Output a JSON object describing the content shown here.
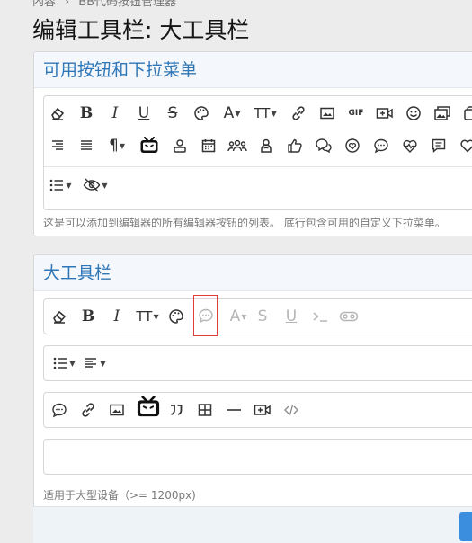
{
  "breadcrumb": {
    "part1": "内容",
    "part2": "BB代码按钮管理器"
  },
  "page": {
    "title": "编辑工具栏: 大工具栏"
  },
  "available_panel": {
    "title": "可用按钮和下拉菜单",
    "hint": "这是可以添加到编辑器的所有编辑器按钮的列表。 底行包含可用的自定义下拉菜单。",
    "icons_row1": [
      "clear-formatting-icon",
      "bold-icon",
      "italic-icon",
      "underline-icon",
      "strikethrough-icon",
      "palette-icon",
      "font-size-icon",
      "text-size-icon",
      "link-icon",
      "image-icon",
      "gif-icon",
      "video-plus-icon",
      "smile-icon",
      "gallery-icon",
      "more-icon"
    ],
    "icons_row2": [
      "align-right-icon",
      "justify-icon",
      "paragraph-icon",
      "bilibili-tv-icon",
      "user-card-icon",
      "calendar-icon",
      "group-icon",
      "contact-icon",
      "thumbs-up-icon",
      "chat-bubbles-icon",
      "heart-shield-icon",
      "comment-icon",
      "heartbeat-icon",
      "message-box-icon",
      "heart-icon"
    ],
    "icons_row3": [
      "list-dropdown-icon",
      "hide-eye-icon"
    ],
    "labels": {
      "bold": "B",
      "italic": "I",
      "underline": "U",
      "strike": "S",
      "font": "A",
      "text_size": "TT",
      "gif": "GIF",
      "paragraph": "¶"
    }
  },
  "toolbar_panel": {
    "title": "大工具栏",
    "hint": "适用于大型设备（>= 1200px)",
    "labels": {
      "bold": "B",
      "italic": "I",
      "text_size": "TT",
      "font": "A",
      "strike": "S",
      "underline": "U"
    },
    "row1": [
      "clear-formatting-icon",
      "bold-icon",
      "italic-icon",
      "text-size-icon",
      "palette-icon",
      "comment-placeholder-icon",
      "font-color-icon",
      "strikethrough-icon",
      "underline-icon",
      "code-inline-icon",
      "spoiler-icon"
    ],
    "row2": [
      "list-icon",
      "align-icon"
    ],
    "row3": [
      "comment-icon",
      "link-icon",
      "image-icon",
      "bilibili-tv-icon",
      "quote-icon",
      "table-icon",
      "horizontal-rule-icon",
      "video-plus-icon",
      "code-icon"
    ]
  },
  "colors": {
    "accent": "#2f76b6",
    "highlight": "#e23b3b",
    "primary_button": "#3a8edd"
  }
}
